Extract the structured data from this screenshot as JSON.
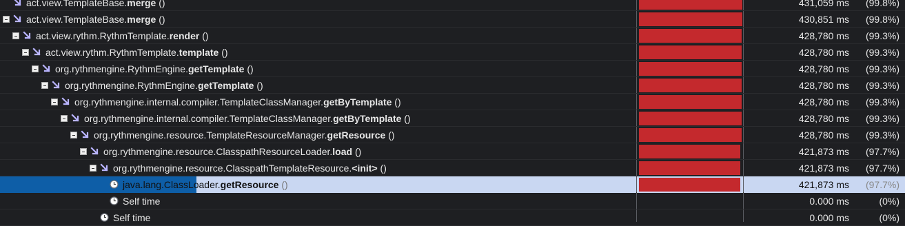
{
  "colors": {
    "background": "#1e1f22",
    "bar": "#c4292d",
    "selected_row": "#c9d7f2",
    "selected_stripe": "#0e5ea7",
    "arrow_icon": "#b9b4ff"
  },
  "rows": [
    {
      "indent": 0,
      "icon": "down-right-arrow-icon",
      "toggle": false,
      "prefix": "act.view.TemplateBase.",
      "method": "merge",
      "args": " ()",
      "time": "431,059 ms",
      "pct": "(99.8%)",
      "bar_fraction": 0.998
    },
    {
      "indent": 0,
      "icon": "down-right-arrow-icon",
      "toggle": true,
      "prefix": "act.view.TemplateBase.",
      "method": "merge",
      "args": " ()",
      "time": "430,851 ms",
      "pct": "(99.8%)",
      "bar_fraction": 0.998
    },
    {
      "indent": 1,
      "icon": "down-right-arrow-icon",
      "toggle": true,
      "prefix": "act.view.rythm.RythmTemplate.",
      "method": "render",
      "args": " ()",
      "time": "428,780 ms",
      "pct": "(99.3%)",
      "bar_fraction": 0.993
    },
    {
      "indent": 2,
      "icon": "down-right-arrow-icon",
      "toggle": true,
      "prefix": "act.view.rythm.RythmTemplate.",
      "method": "template",
      "args": " ()",
      "time": "428,780 ms",
      "pct": "(99.3%)",
      "bar_fraction": 0.993
    },
    {
      "indent": 3,
      "icon": "down-right-arrow-icon",
      "toggle": true,
      "prefix": "org.rythmengine.RythmEngine.",
      "method": "getTemplate",
      "args": " ()",
      "time": "428,780 ms",
      "pct": "(99.3%)",
      "bar_fraction": 0.993
    },
    {
      "indent": 4,
      "icon": "down-right-arrow-icon",
      "toggle": true,
      "prefix": "org.rythmengine.RythmEngine.",
      "method": "getTemplate",
      "args": " ()",
      "time": "428,780 ms",
      "pct": "(99.3%)",
      "bar_fraction": 0.993
    },
    {
      "indent": 5,
      "icon": "down-right-arrow-icon",
      "toggle": true,
      "prefix": "org.rythmengine.internal.compiler.TemplateClassManager.",
      "method": "getByTemplate",
      "args": " ()",
      "time": "428,780 ms",
      "pct": "(99.3%)",
      "bar_fraction": 0.993
    },
    {
      "indent": 6,
      "icon": "down-right-arrow-icon",
      "toggle": true,
      "prefix": "org.rythmengine.internal.compiler.TemplateClassManager.",
      "method": "getByTemplate",
      "args": " ()",
      "time": "428,780 ms",
      "pct": "(99.3%)",
      "bar_fraction": 0.993
    },
    {
      "indent": 7,
      "icon": "down-right-arrow-icon",
      "toggle": true,
      "prefix": "org.rythmengine.resource.TemplateResourceManager.",
      "method": "getResource",
      "args": " ()",
      "time": "428,780 ms",
      "pct": "(99.3%)",
      "bar_fraction": 0.993
    },
    {
      "indent": 8,
      "icon": "down-right-arrow-icon",
      "toggle": true,
      "prefix": "org.rythmengine.resource.ClasspathResourceLoader.",
      "method": "load",
      "args": " ()",
      "time": "421,873 ms",
      "pct": "(97.7%)",
      "bar_fraction": 0.977
    },
    {
      "indent": 9,
      "icon": "down-right-arrow-icon",
      "toggle": true,
      "prefix": "org.rythmengine.resource.ClasspathTemplateResource.",
      "method": "<init>",
      "args": " ()",
      "time": "421,873 ms",
      "pct": "(97.7%)",
      "bar_fraction": 0.977
    },
    {
      "indent": 10,
      "icon": "clock-icon",
      "toggle": false,
      "selected": true,
      "prefix": "java.lang.ClassLoader.",
      "method": "getResource",
      "args": " ()",
      "time": "421,873 ms",
      "pct": "(97.7%)",
      "bar_fraction": 0.977
    },
    {
      "indent": 10,
      "icon": "clock-icon",
      "toggle": false,
      "prefix": "Self time",
      "method": "",
      "args": "",
      "time": "0.000 ms",
      "pct": "(0%)",
      "bar_fraction": 0
    },
    {
      "indent": 9,
      "icon": "clock-icon",
      "toggle": false,
      "prefix": "Self time",
      "method": "",
      "args": "",
      "time": "0.000 ms",
      "pct": "(0%)",
      "bar_fraction": 0
    }
  ]
}
